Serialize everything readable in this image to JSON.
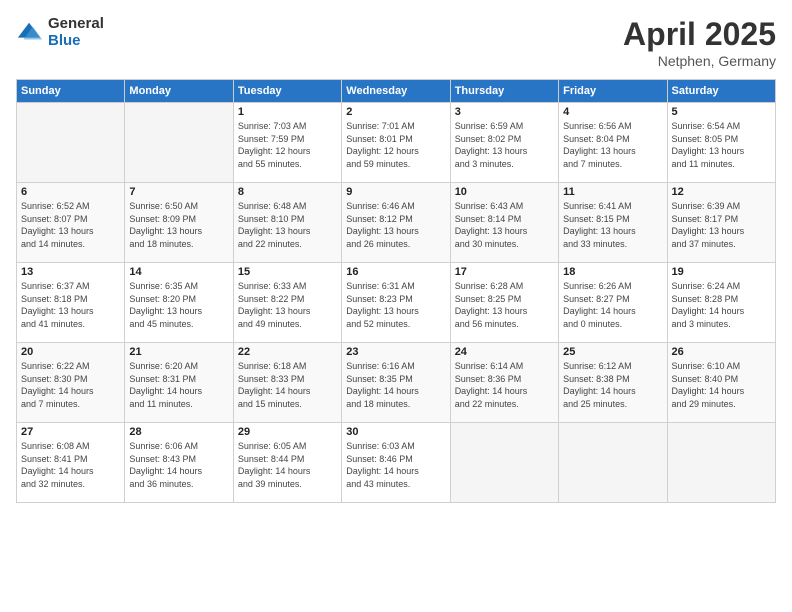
{
  "logo": {
    "general": "General",
    "blue": "Blue"
  },
  "title": {
    "month": "April 2025",
    "location": "Netphen, Germany"
  },
  "weekdays": [
    "Sunday",
    "Monday",
    "Tuesday",
    "Wednesday",
    "Thursday",
    "Friday",
    "Saturday"
  ],
  "weeks": [
    [
      {
        "day": "",
        "info": ""
      },
      {
        "day": "",
        "info": ""
      },
      {
        "day": "1",
        "info": "Sunrise: 7:03 AM\nSunset: 7:59 PM\nDaylight: 12 hours\nand 55 minutes."
      },
      {
        "day": "2",
        "info": "Sunrise: 7:01 AM\nSunset: 8:01 PM\nDaylight: 12 hours\nand 59 minutes."
      },
      {
        "day": "3",
        "info": "Sunrise: 6:59 AM\nSunset: 8:02 PM\nDaylight: 13 hours\nand 3 minutes."
      },
      {
        "day": "4",
        "info": "Sunrise: 6:56 AM\nSunset: 8:04 PM\nDaylight: 13 hours\nand 7 minutes."
      },
      {
        "day": "5",
        "info": "Sunrise: 6:54 AM\nSunset: 8:05 PM\nDaylight: 13 hours\nand 11 minutes."
      }
    ],
    [
      {
        "day": "6",
        "info": "Sunrise: 6:52 AM\nSunset: 8:07 PM\nDaylight: 13 hours\nand 14 minutes."
      },
      {
        "day": "7",
        "info": "Sunrise: 6:50 AM\nSunset: 8:09 PM\nDaylight: 13 hours\nand 18 minutes."
      },
      {
        "day": "8",
        "info": "Sunrise: 6:48 AM\nSunset: 8:10 PM\nDaylight: 13 hours\nand 22 minutes."
      },
      {
        "day": "9",
        "info": "Sunrise: 6:46 AM\nSunset: 8:12 PM\nDaylight: 13 hours\nand 26 minutes."
      },
      {
        "day": "10",
        "info": "Sunrise: 6:43 AM\nSunset: 8:14 PM\nDaylight: 13 hours\nand 30 minutes."
      },
      {
        "day": "11",
        "info": "Sunrise: 6:41 AM\nSunset: 8:15 PM\nDaylight: 13 hours\nand 33 minutes."
      },
      {
        "day": "12",
        "info": "Sunrise: 6:39 AM\nSunset: 8:17 PM\nDaylight: 13 hours\nand 37 minutes."
      }
    ],
    [
      {
        "day": "13",
        "info": "Sunrise: 6:37 AM\nSunset: 8:18 PM\nDaylight: 13 hours\nand 41 minutes."
      },
      {
        "day": "14",
        "info": "Sunrise: 6:35 AM\nSunset: 8:20 PM\nDaylight: 13 hours\nand 45 minutes."
      },
      {
        "day": "15",
        "info": "Sunrise: 6:33 AM\nSunset: 8:22 PM\nDaylight: 13 hours\nand 49 minutes."
      },
      {
        "day": "16",
        "info": "Sunrise: 6:31 AM\nSunset: 8:23 PM\nDaylight: 13 hours\nand 52 minutes."
      },
      {
        "day": "17",
        "info": "Sunrise: 6:28 AM\nSunset: 8:25 PM\nDaylight: 13 hours\nand 56 minutes."
      },
      {
        "day": "18",
        "info": "Sunrise: 6:26 AM\nSunset: 8:27 PM\nDaylight: 14 hours\nand 0 minutes."
      },
      {
        "day": "19",
        "info": "Sunrise: 6:24 AM\nSunset: 8:28 PM\nDaylight: 14 hours\nand 3 minutes."
      }
    ],
    [
      {
        "day": "20",
        "info": "Sunrise: 6:22 AM\nSunset: 8:30 PM\nDaylight: 14 hours\nand 7 minutes."
      },
      {
        "day": "21",
        "info": "Sunrise: 6:20 AM\nSunset: 8:31 PM\nDaylight: 14 hours\nand 11 minutes."
      },
      {
        "day": "22",
        "info": "Sunrise: 6:18 AM\nSunset: 8:33 PM\nDaylight: 14 hours\nand 15 minutes."
      },
      {
        "day": "23",
        "info": "Sunrise: 6:16 AM\nSunset: 8:35 PM\nDaylight: 14 hours\nand 18 minutes."
      },
      {
        "day": "24",
        "info": "Sunrise: 6:14 AM\nSunset: 8:36 PM\nDaylight: 14 hours\nand 22 minutes."
      },
      {
        "day": "25",
        "info": "Sunrise: 6:12 AM\nSunset: 8:38 PM\nDaylight: 14 hours\nand 25 minutes."
      },
      {
        "day": "26",
        "info": "Sunrise: 6:10 AM\nSunset: 8:40 PM\nDaylight: 14 hours\nand 29 minutes."
      }
    ],
    [
      {
        "day": "27",
        "info": "Sunrise: 6:08 AM\nSunset: 8:41 PM\nDaylight: 14 hours\nand 32 minutes."
      },
      {
        "day": "28",
        "info": "Sunrise: 6:06 AM\nSunset: 8:43 PM\nDaylight: 14 hours\nand 36 minutes."
      },
      {
        "day": "29",
        "info": "Sunrise: 6:05 AM\nSunset: 8:44 PM\nDaylight: 14 hours\nand 39 minutes."
      },
      {
        "day": "30",
        "info": "Sunrise: 6:03 AM\nSunset: 8:46 PM\nDaylight: 14 hours\nand 43 minutes."
      },
      {
        "day": "",
        "info": ""
      },
      {
        "day": "",
        "info": ""
      },
      {
        "day": "",
        "info": ""
      }
    ]
  ]
}
